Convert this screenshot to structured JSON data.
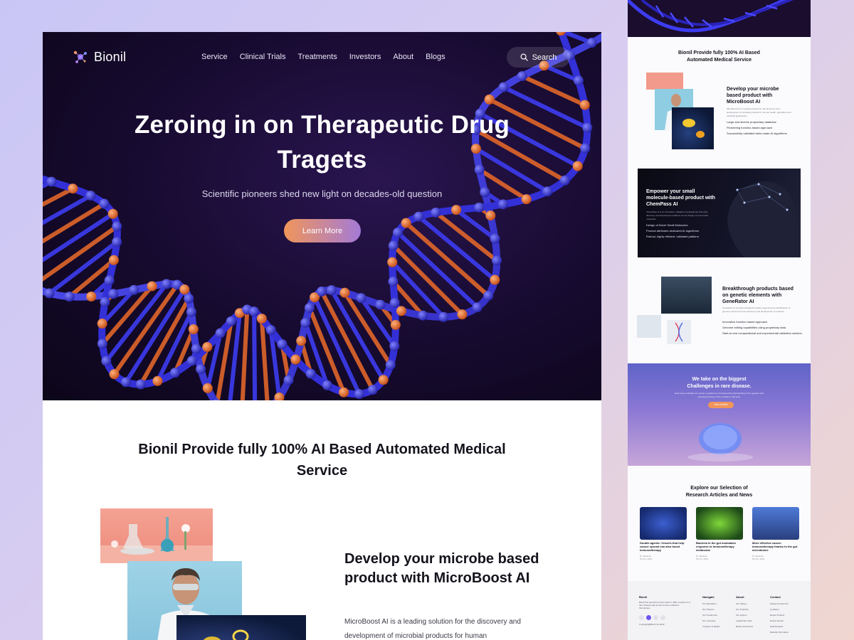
{
  "brand": {
    "name": "Bionil"
  },
  "nav": {
    "items": [
      "Service",
      "Clinical Trials",
      "Treatments",
      "Investors",
      "About",
      "Blogs"
    ],
    "search_label": "Search"
  },
  "hero": {
    "title": "Zeroing in on Therapeutic Drug Tragets",
    "subtitle": "Scientific pioneers shed new light on decades-old question",
    "cta": "Learn More"
  },
  "section": {
    "title": "Bionil Provide fully 100% AI Based Automated Medical Service"
  },
  "feature": {
    "title": "Develop your microbe based product with MicroBoost AI",
    "text": "MicroBoost AI is a leading solution for the discovery and development of microbial products for human"
  },
  "preview": {
    "section_title": "Bionil Provide fully 100% AI Based Automated Medical Service",
    "microboost": {
      "title": "Develop your microbe based product with MicroBoost AI",
      "text": "MicroBoost AI is a leading solution for the discovery and development of microbial products for human health, agriculture and industrial applications.",
      "bullets": [
        "Large and diverse proprietary database",
        "Pioneering function-based approach",
        "Successfully validated tailor-made AI algorithms"
      ]
    },
    "chempass": {
      "title": "Empower your small molecule-based product with ChemPass AI",
      "text": "ChemPass AI is an innovative, validated computational chemistry discovery and development platform for the design of novel small molecules.",
      "bullets": [
        "Design of Novel Small Molecules",
        "Product attributes dedicated AI algorithms",
        "Robust, highly efficient, validated platform"
      ]
    },
    "generator": {
      "title": "Breakthrough products based on genetic elements with GeneRator AI",
      "text": "GeneRator AI provides biological insights supporting the identification of genomic elements for the discovery and development of products.",
      "bullets": [
        "Innovative function based approach",
        "Genome editing capabilities using proprietary data",
        "Start-to-end computational and experimental validation solution"
      ]
    },
    "promo": {
      "title": "We take on the biggest Challenges in rare disease.",
      "text": "Each drug candidate we pursue is guided by a fundamental understanding of the genetics and underlying biology of the condition it will treat.",
      "cta": "View Details"
    },
    "articles": {
      "title": "Explore our Selection of Research Articles and News",
      "items": [
        {
          "title": "Double agents: Vessels that help cancer spread can also boost immunotherapy",
          "author": "Dr. Martison",
          "date": "01 Oct, 2022"
        },
        {
          "title": "Bacteria in the gut modulates response to immunotherapy melanoma",
          "author": "Dr. Martison",
          "date": "01 Oct, 2022"
        },
        {
          "title": "More effective cancer immunotherapy thanks to the gut microbiome",
          "author": "Dr. Martison",
          "date": "01 Oct, 2022"
        }
      ]
    },
    "footer": {
      "brand": "Bionil",
      "about_text": "Bionil first opened its doors back in 1997, treatment of rare disease was as rare as the conditions themselves.",
      "copyright": "Copyright@Bionil Inc 2022",
      "columns": [
        {
          "heading": "Navigate",
          "items": [
            "Our Motivation",
            "Our Science",
            "Our Treatments",
            "Our Company",
            "Investors & Media"
          ]
        },
        {
          "heading": "About",
          "items": [
            "Our History",
            "Our Products",
            "Our Hydros",
            "Leadership Team",
            "Board of Directors"
          ]
        },
        {
          "heading": "Contact",
          "items": [
            "Global Contact Info",
            "Locations",
            "Report Product",
            "Report Events",
            "Data Request",
            "Medical Information"
          ]
        }
      ]
    }
  },
  "colors": {
    "hero_bg": "#160a2e",
    "dna_blue": "#3d3cf0",
    "dna_orange": "#f07a3a",
    "cta_gradient_start": "#f0955a",
    "cta_gradient_end": "#a47ad6"
  }
}
